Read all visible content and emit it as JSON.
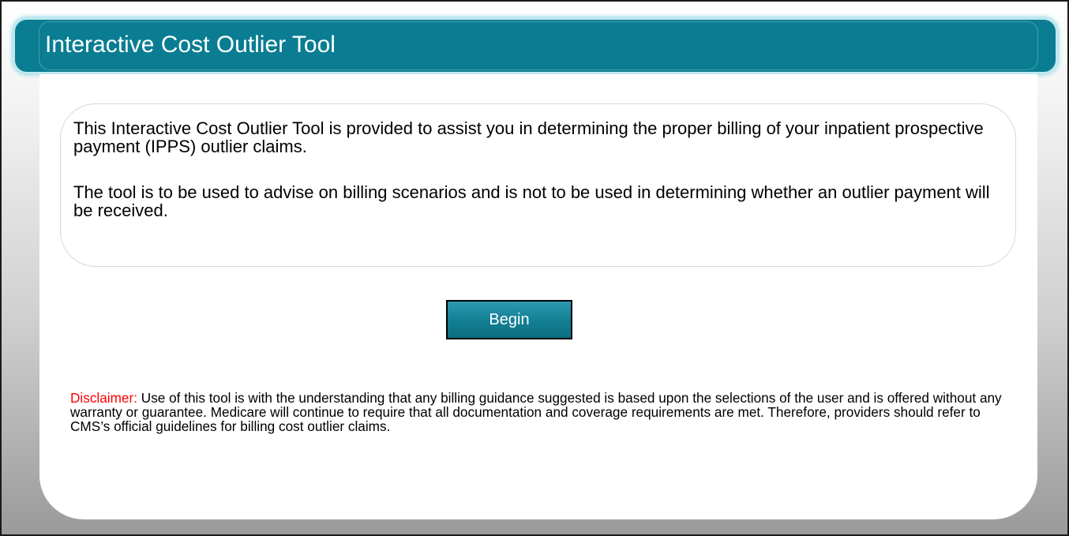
{
  "header": {
    "title": "Interactive Cost Outlier Tool"
  },
  "intro": {
    "paragraph1": "This Interactive Cost Outlier Tool is provided to assist you in determining the proper billing of your inpatient prospective payment (IPPS) outlier claims.",
    "paragraph2": "The tool is to be used to advise on billing scenarios and is not to be used in determining whether an outlier payment will be received."
  },
  "actions": {
    "begin_label": "Begin"
  },
  "disclaimer": {
    "label": "Disclaimer:",
    "text": " Use of this tool is with the understanding that any billing guidance suggested is based upon the selections of the user and is offered without any warranty or guarantee. Medicare will continue to require that all documentation and coverage requirements are met. Therefore, providers should refer to CMS’s official guidelines for billing cost outlier claims."
  },
  "colors": {
    "header_background": "#0a7d92",
    "button_background": "#127e93",
    "disclaimer_label": "#ff0000"
  }
}
